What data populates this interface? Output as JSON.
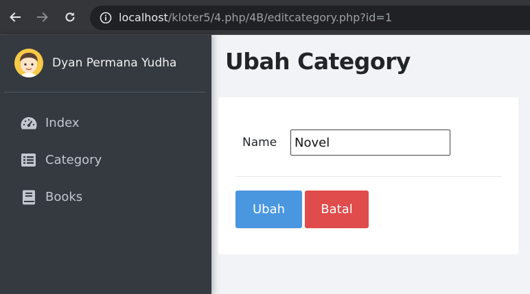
{
  "browser": {
    "url_host": "localhost",
    "url_path": "/kloter5/4.php/4B/editcategory.php?id=1",
    "icons": [
      "back-arrow-icon",
      "forward-arrow-icon",
      "reload-icon",
      "info-icon"
    ]
  },
  "sidebar": {
    "user_name": "Dyan Permana Yudha",
    "items": [
      {
        "label": "Index",
        "icon": "dashboard-gauge-icon"
      },
      {
        "label": "Category",
        "icon": "list-icon"
      },
      {
        "label": "Books",
        "icon": "book-icon"
      }
    ]
  },
  "main": {
    "title": "Ubah Category",
    "form": {
      "name_label": "Name",
      "name_value": "Novel"
    },
    "buttons": {
      "submit_label": "Ubah",
      "cancel_label": "Batal"
    }
  },
  "colors": {
    "sidebar_bg": "#343a40",
    "primary": "#4a97e0",
    "danger": "#e04b4b",
    "content_bg": "#f1f3f6"
  }
}
